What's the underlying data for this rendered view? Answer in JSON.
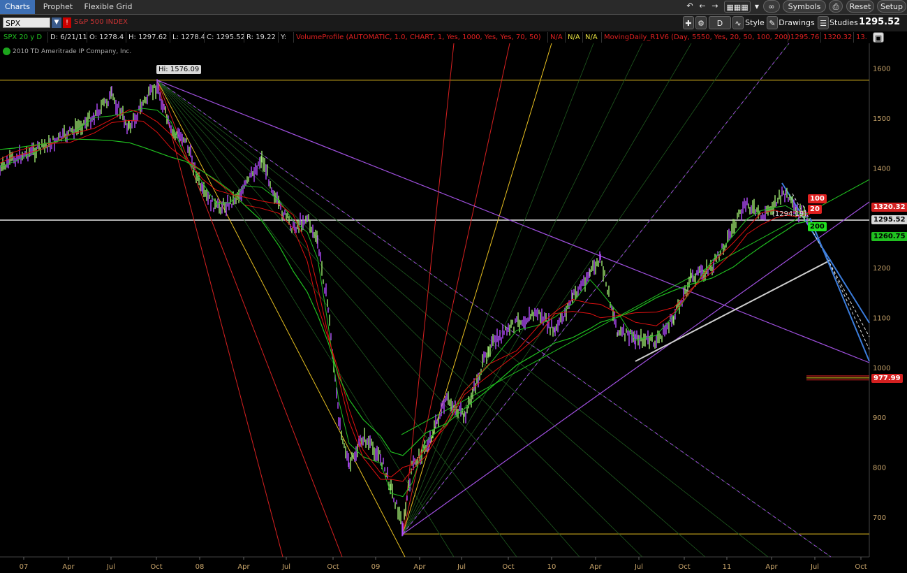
{
  "tabs": [
    "Charts",
    "Prophet",
    "Flexible Grid"
  ],
  "toolbar": {
    "symbol": "SPX",
    "symbol_desc": "S&P 500 INDEX",
    "timeframe": "D",
    "style_label": "Style",
    "drawings_label": "Drawings",
    "studies_label": "Studies",
    "symbols_label": "Symbols",
    "reset_label": "Reset",
    "setup_label": "Setup",
    "last_price": "1295.52"
  },
  "study_bar": {
    "series": "SPX 20 y D",
    "date": "D: 6/21/11",
    "open": "O: 1278.4",
    "high": "H: 1297.62",
    "low": "L: 1278.4",
    "close": "C: 1295.52",
    "range": "R: 19.22",
    "y": "Y:",
    "volume_profile": "VolumeProfile (AUTOMATIC, 1.0, CHART, 1, Yes, 1000, Yes, Yes, 70, 50)",
    "na1": "N/A",
    "na2": "N/A",
    "na3": "N/A",
    "moving_daily": "MovingDaily_R1V6 (Day, 5550, Yes, 20, 50, 100, 200)",
    "md_v1": "1295.76",
    "md_v2": "1320.32",
    "md_v3": "13."
  },
  "copyright": "2010 TD Ameritrade IP Company, Inc.",
  "annotations": {
    "hi_label": "Hi: 1576.09",
    "inline_label": "(1294.19)",
    "tag_100": "100",
    "tag_20": "20",
    "tag_200": "200"
  },
  "price_tags": {
    "p1": "1320.32",
    "p2": "1295.52",
    "p3": "1260.75",
    "p4": "977.99"
  },
  "colors": {
    "tab_active": "#3d6fb4",
    "bars_up": "#9de870",
    "bars_down": "#b44cff",
    "ma_red": "#e01010",
    "ma_green": "#20c020",
    "fan_yellow": "#e8c020",
    "trend_purple": "#a050e0",
    "channel_blue": "#3b7ddd",
    "axis": "#c8a46a"
  },
  "chart_data": {
    "type": "line",
    "title": "SPX",
    "xlabel": "",
    "ylabel": "",
    "ylim": [
      620,
      1650
    ],
    "y_ticks": [
      "1600",
      "1500",
      "1400",
      "1300",
      "1200",
      "1100",
      "1000",
      "900",
      "800",
      "700"
    ],
    "x_ticks": [
      "07",
      "Apr",
      "Jul",
      "Oct",
      "08",
      "Apr",
      "Jul",
      "Oct",
      "09",
      "Apr",
      "Jul",
      "Oct",
      "10",
      "Apr",
      "Jul",
      "Oct",
      "11",
      "Apr",
      "Jul",
      "Oct"
    ],
    "series": [
      {
        "name": "SPX",
        "x": [
          0,
          20,
          60,
          100,
          135,
          160,
          185,
          205,
          225,
          245,
          265,
          290,
          310,
          330,
          350,
          375,
          400,
          420,
          440,
          455,
          470,
          485,
          500,
          520,
          545,
          560,
          577,
          590,
          610,
          640,
          665,
          700,
          740,
          770,
          795,
          820,
          845,
          860,
          885,
          910,
          940,
          965,
          990,
          1020,
          1050,
          1070,
          1090,
          1110,
          1125,
          1140,
          1160
        ],
        "values": [
          1395,
          1420,
          1440,
          1470,
          1505,
          1545,
          1480,
          1530,
          1565,
          1470,
          1460,
          1350,
          1320,
          1330,
          1360,
          1420,
          1320,
          1280,
          1300,
          1250,
          1120,
          900,
          800,
          860,
          820,
          760,
          680,
          800,
          840,
          935,
          900,
          1040,
          1090,
          1110,
          1070,
          1140,
          1190,
          1215,
          1070,
          1060,
          1050,
          1100,
          1180,
          1200,
          1280,
          1330,
          1300,
          1330,
          1350,
          1310,
          1295
        ]
      }
    ],
    "levels": [
      {
        "value": 1576.09,
        "label": "Hi: 1576.09"
      },
      {
        "value": 1295.52,
        "label": "1295.52"
      },
      {
        "value": 666,
        "label": ""
      }
    ]
  }
}
